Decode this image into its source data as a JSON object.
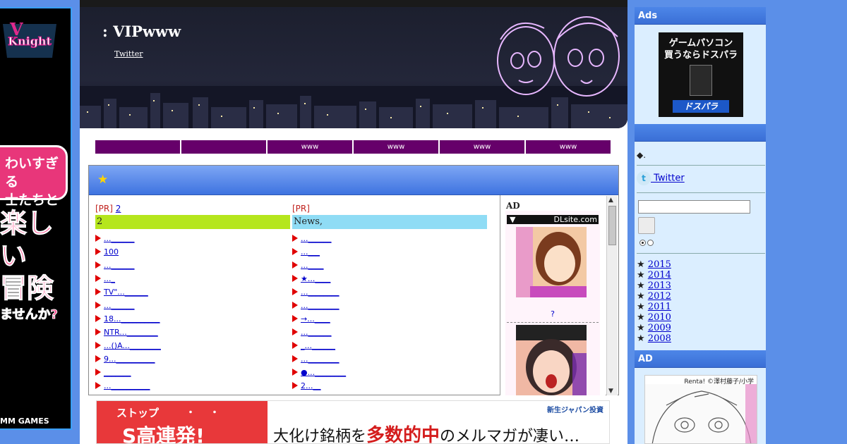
{
  "site": {
    "title": ": VIPwww",
    "twitter_link": "Twitter"
  },
  "nav": {
    "items": [
      "",
      "",
      "www",
      "www",
      "www",
      "www"
    ]
  },
  "content": {
    "left": {
      "pr_prefix": "[PR]",
      "pr_link": "2",
      "category": "2",
      "category_color": "#b5e61d",
      "items": [
        "...______",
        "100",
        "...______",
        "..._",
        "TV\"...______",
        "...______",
        "18...__________",
        "NTR...________",
        "...()A...________",
        "9...__________",
        "_______",
        "...__________"
      ]
    },
    "right": {
      "pr_prefix": "[PR]",
      "pr_link": "",
      "category": "News,",
      "category_color": "#8fdcf5",
      "items": [
        "...______",
        "...___",
        "...____",
        "★...____",
        "...________",
        "...________",
        "→...____",
        "...______",
        "_...______",
        "...________",
        "●...________",
        "2...__"
      ]
    },
    "ad": {
      "label": "AD",
      "bar_arrow": "▼",
      "bar_site": "DLsite.com",
      "caption": "?"
    }
  },
  "bottom_banner": {
    "stop": "ストップ",
    "dots": "・・",
    "big": "S高連発!",
    "brand": "新生ジャパン投資",
    "headline_pre": "大化け銘柄を",
    "headline_highlight": "多数的中",
    "headline_post": "のメルマガが凄い…"
  },
  "left_ad": {
    "pink_line1": "わいすぎる",
    "pink_line2": "士たちと",
    "big_line1": "楽しい",
    "big_line2": "冒険",
    "big_line3": "ませんか?",
    "footer": "MM GAMES"
  },
  "sidebar": {
    "ads_heading": "Ads",
    "dospara_line1": "ゲームパソコン",
    "dospara_line2": "買うならドスパラ",
    "dospara_logo": "ドスパラ",
    "blank_heading": "",
    "diamond_text": "◆.",
    "twitter_text": " Twitter ",
    "twitter_icon": "t",
    "archives": [
      "2015",
      "2014",
      "2013",
      "2012",
      "2011",
      "2010",
      "2009",
      "2008"
    ],
    "archive_bullet": "★",
    "ad_heading": "AD",
    "manga_credit": "Renta! ©澤村藤子/小学"
  },
  "colors": {
    "nav_bg": "#66006a",
    "sidebar_bg": "#dbeeff",
    "heading_blue": "#3e73e0",
    "page_bg": "#5b8fe8"
  }
}
